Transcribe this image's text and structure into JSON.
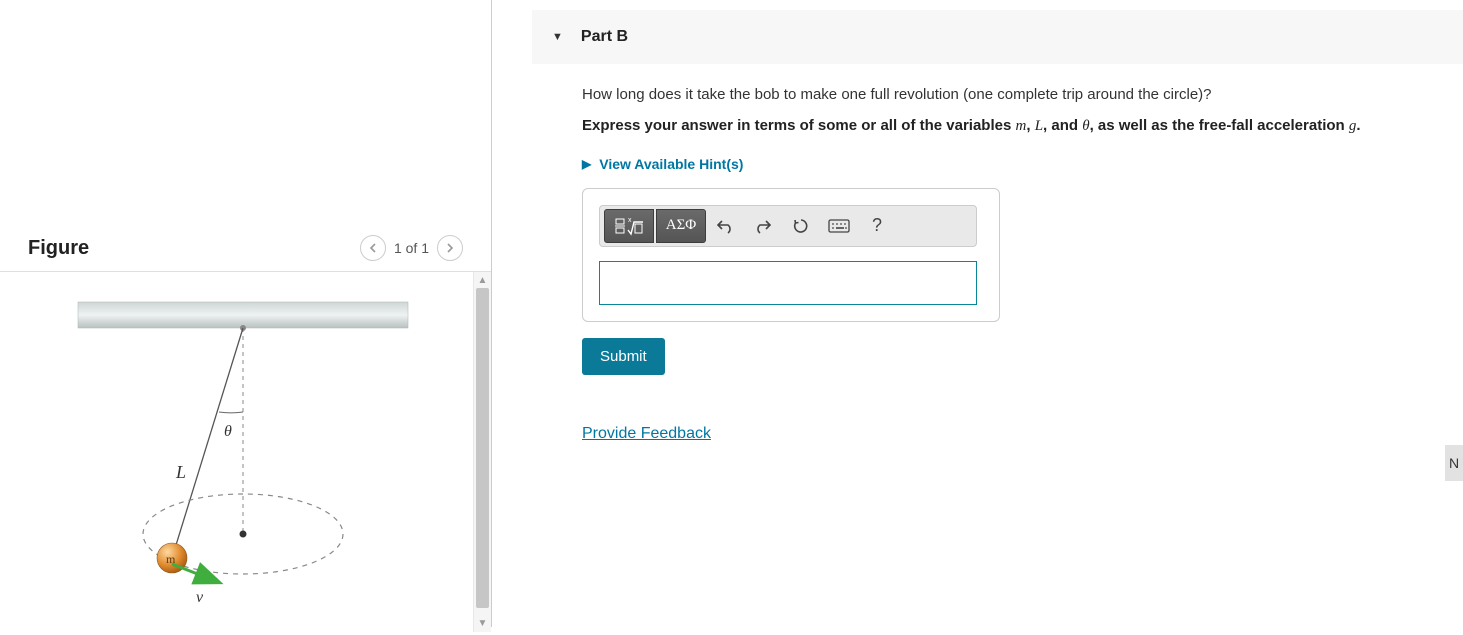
{
  "figure": {
    "title": "Figure",
    "nav_counter": "1 of 1",
    "labels": {
      "theta": "θ",
      "L": "L",
      "m": "m",
      "v": "v"
    }
  },
  "part": {
    "caret": "▼",
    "title": "Part B"
  },
  "question": {
    "text": "How long does it take the bob to make one full revolution (one complete trip around the circle)?",
    "express_prefix": "Express your answer in terms of some or all of the variables ",
    "var_m": "m",
    "sep1": ", ",
    "var_L": "L",
    "sep2": ", and ",
    "var_theta": "θ",
    "express_mid": ", as well as the free-fall acceleration ",
    "var_g": "g",
    "express_suffix": "."
  },
  "hints": {
    "caret": "▶",
    "label": "View Available Hint(s)"
  },
  "toolbar": {
    "templates_label": "√",
    "greek_label": "ΑΣΦ",
    "undo_label": "↶",
    "redo_label": "↷",
    "reset_label": "↻",
    "keyboard_label": "⌨",
    "help_label": "?"
  },
  "answer": {
    "value": ""
  },
  "buttons": {
    "submit": "Submit"
  },
  "feedback": {
    "link": "Provide Feedback"
  },
  "next_stub": "N"
}
